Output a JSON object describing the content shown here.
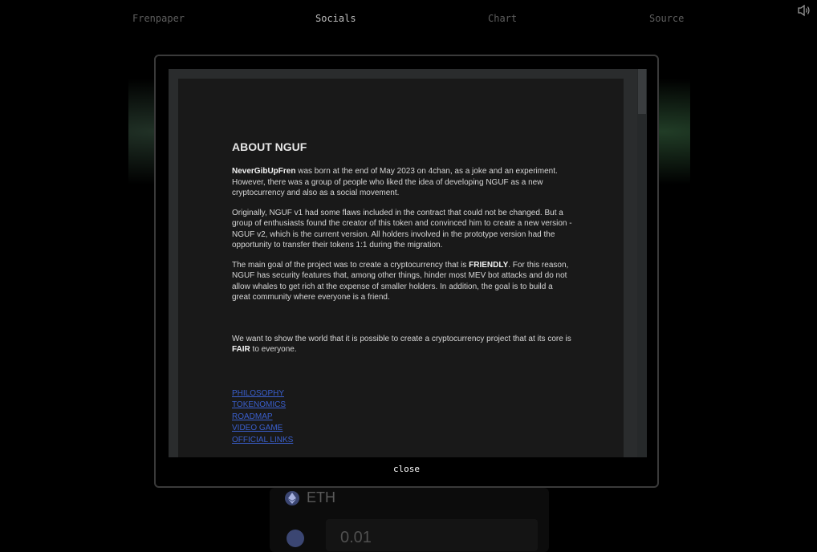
{
  "nav": {
    "items": [
      {
        "label": "Frenpaper"
      },
      {
        "label": "Socials"
      },
      {
        "label": "Chart"
      },
      {
        "label": "Source"
      }
    ],
    "active": "Socials"
  },
  "background": {
    "token_label": "ETH",
    "amount_value": "0.01"
  },
  "modal": {
    "title": "ABOUT NGUF",
    "p1": {
      "bold": "NeverGibUpFren",
      "text": " was born at the end of May 2023 on 4chan, as a joke and an experiment. However, there was a group of people who liked the idea of developing NGUF as a new cryptocurrency and also as a social movement."
    },
    "p2": "Originally, NGUF v1 had some flaws included in the contract that could not be changed. But a group of enthusiasts found the creator of this token and convinced him to create a new version - NGUF v2, which is the current version. All holders involved in the prototype version had the opportunity to transfer their tokens 1:1 during the migration.",
    "p3": {
      "pre": "The main goal of the project was to create a cryptocurrency that is ",
      "bold": "FRIENDLY",
      "post": ". For this reason, NGUF has security features that, among other things, hinder most MEV bot attacks and do not allow whales to get rich at the expense of smaller holders. In addition, the goal is to build a great community where everyone is a friend."
    },
    "p4": {
      "pre": "We want to show the world that it is possible to create a cryptocurrency project that at its core is ",
      "bold": "FAIR",
      "post": " to everyone."
    },
    "links": [
      "PHILOSOPHY",
      "TOKENOMICS",
      "ROADMAP",
      "VIDEO GAME",
      "OFFICIAL LINKS"
    ],
    "close_label": "close"
  }
}
